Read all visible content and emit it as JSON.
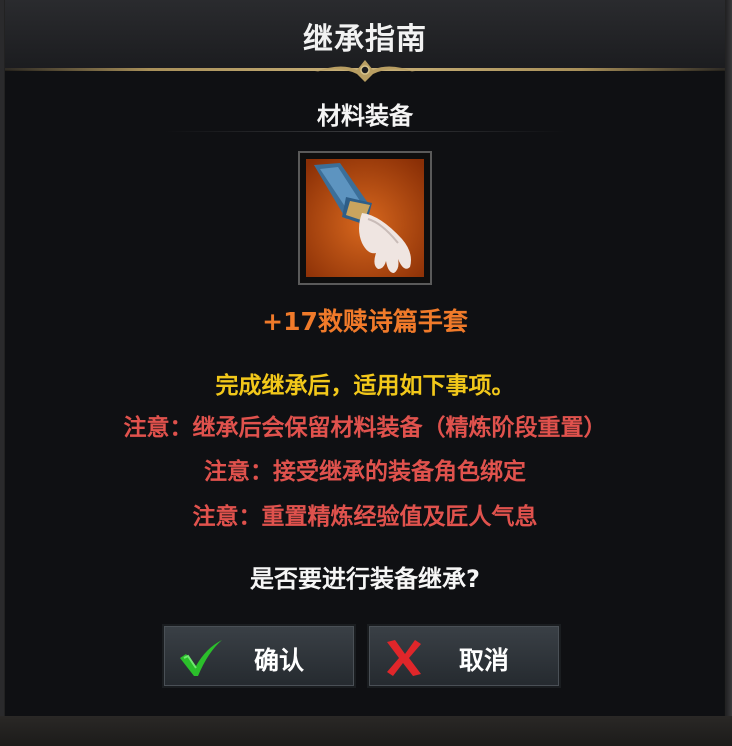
{
  "dialog": {
    "title": "继承指南",
    "section_title": "材料装备",
    "item": {
      "name": "+17救赎诗篇手套",
      "icon": "gauntlet-icon",
      "name_color": "#f07a2a"
    },
    "info": "完成继承后，适用如下事项。",
    "notes": [
      "注意：继承后会保留材料装备（精炼阶段重置）",
      "注意：接受继承的装备角色绑定",
      "注意：重置精炼经验值及匠人气息"
    ],
    "question": "是否要进行装备继承?",
    "buttons": {
      "confirm_label": "确认",
      "cancel_label": "取消"
    }
  },
  "colors": {
    "info": "#f2c81a",
    "note": "#e0524d",
    "confirm_check": "#2bbf2b",
    "cancel_x": "#e0262a"
  }
}
